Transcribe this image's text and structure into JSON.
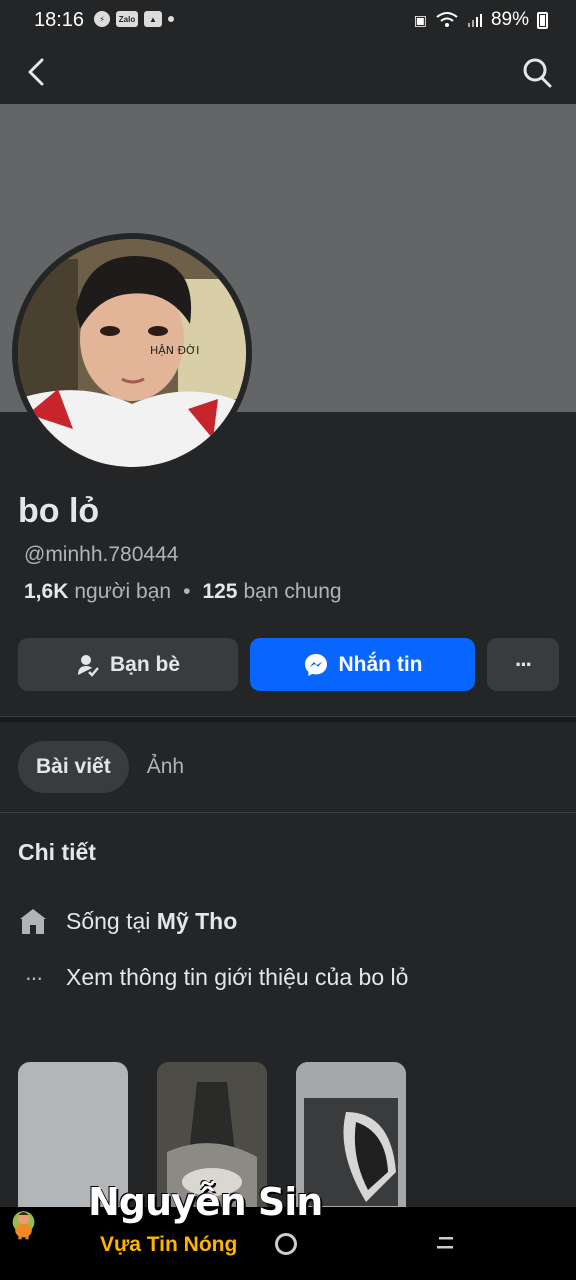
{
  "status_bar": {
    "time": "18:16",
    "zalo_label": "Zalo",
    "battery": "89%"
  },
  "app_bar": {
    "back_icon": "chevron-left-icon",
    "search_icon": "search-icon"
  },
  "profile": {
    "name": "bo lỏ",
    "handle": "@minhh.780444",
    "friends_count": "1,6K",
    "friends_label": "người bạn",
    "separator": "•",
    "mutual_count": "125",
    "mutual_label": "bạn chung",
    "avatar_face_text": "HẬN ĐỜI"
  },
  "actions": {
    "friends_label": "Bạn bè",
    "message_label": "Nhắn tin",
    "more_label": "···"
  },
  "tabs": [
    {
      "label": "Bài viết",
      "active": true
    },
    {
      "label": "Ảnh",
      "active": false
    }
  ],
  "details": {
    "title": "Chi tiết",
    "lives_prefix": "Sống tại",
    "lives_place": "Mỹ Tho",
    "about_link": "Xem thông tin giới thiệu của bo lỏ",
    "more_icon": "···"
  },
  "watermark": {
    "title": "Nguyễn Sin",
    "subtitle": "Vựa Tin Nóng"
  },
  "colors": {
    "background": "#242526",
    "cover": "#636567",
    "primary_button": "#0866ff",
    "secondary_button": "#3a3b3c",
    "muted_text": "#b0b3b8"
  }
}
